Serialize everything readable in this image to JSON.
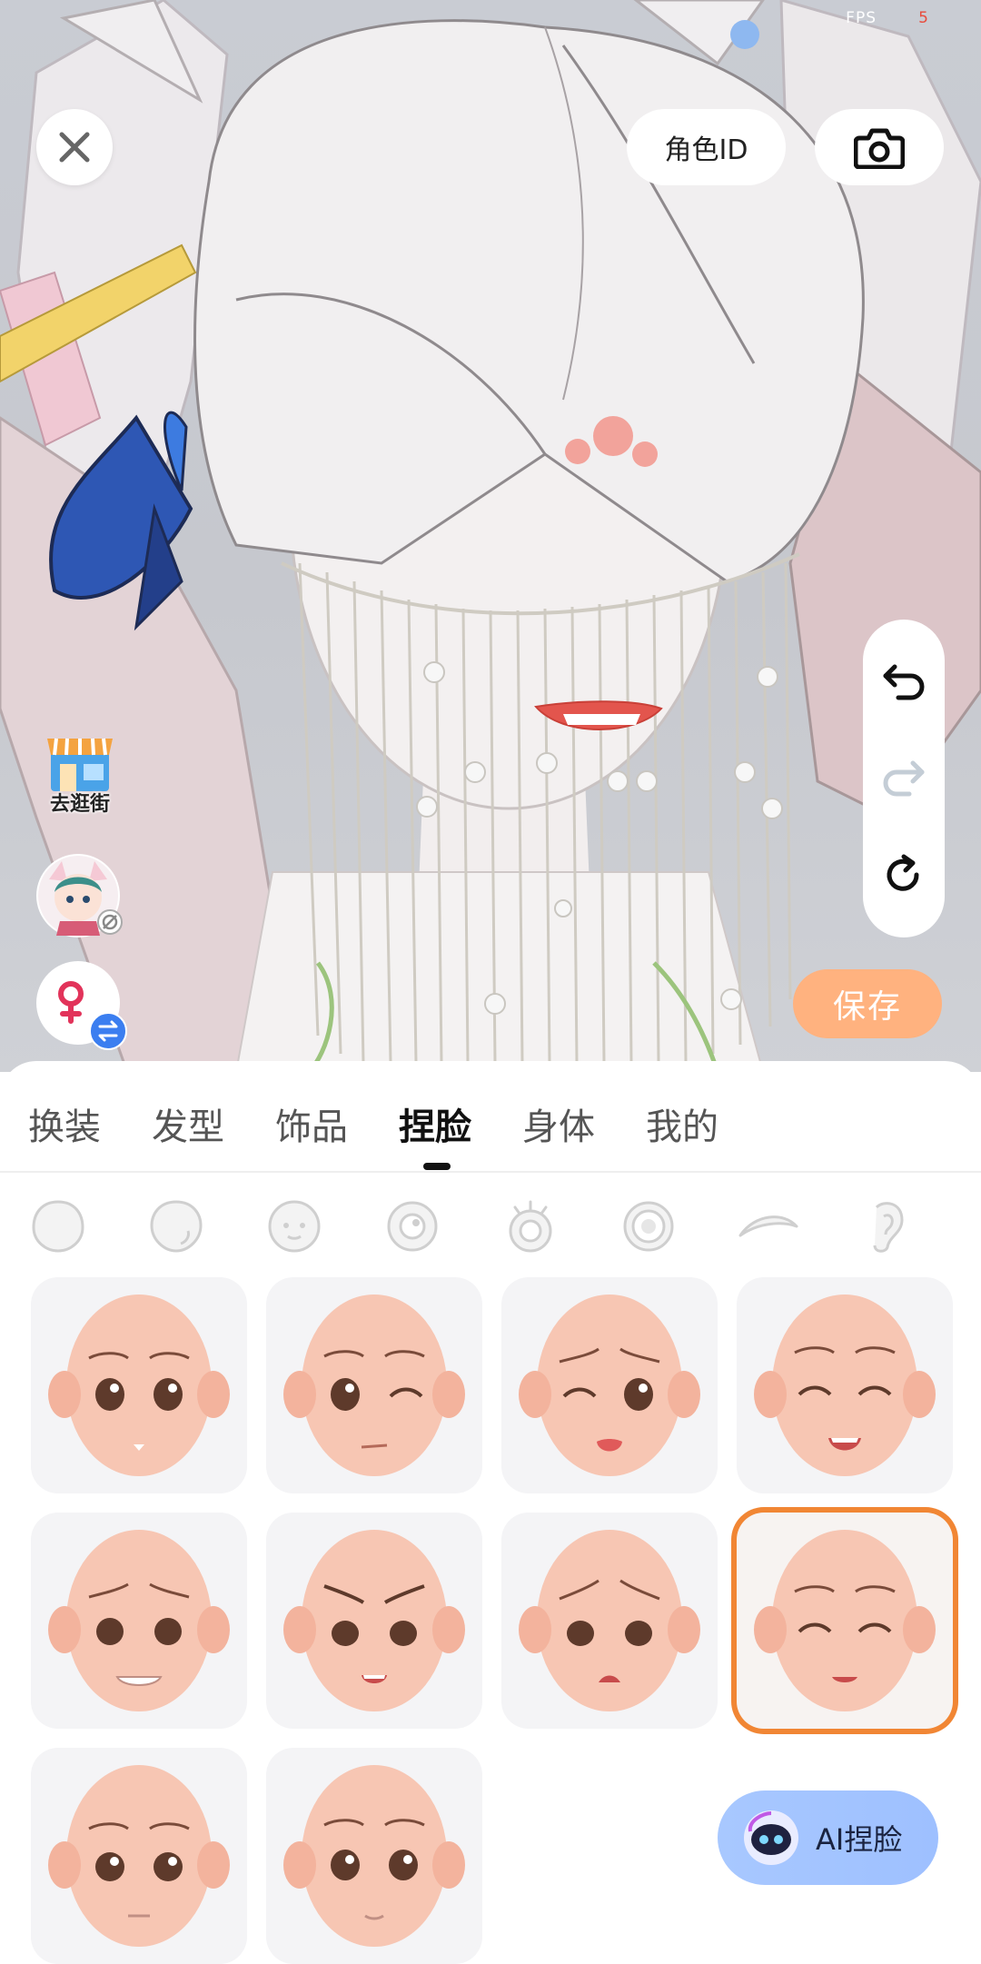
{
  "hud": {
    "fps_label": "FPS",
    "fps_value": "5"
  },
  "top": {
    "close_icon": "close-icon",
    "role_id_label": "角色ID",
    "camera_icon": "camera-icon"
  },
  "side": {
    "shop_label": "去逛街",
    "shop_icon": "storefront-icon",
    "gender_icon": "female-swap-icon"
  },
  "history": {
    "undo_icon": "undo-icon",
    "redo_icon": "redo-icon",
    "reset_icon": "reset-icon"
  },
  "save_label": "保存",
  "tabs": [
    {
      "label": "换装"
    },
    {
      "label": "发型"
    },
    {
      "label": "饰品"
    },
    {
      "label": "捏脸",
      "active": true
    },
    {
      "label": "身体"
    },
    {
      "label": "我的"
    }
  ],
  "subcategories": [
    "face-shape-icon",
    "face-contour-icon",
    "face-features-icon",
    "eye-icon",
    "eyelash-icon",
    "pupil-icon",
    "eyebrow-icon",
    "ear-icon"
  ],
  "face_presets": [
    {
      "name": "neutral-preset",
      "selected": false
    },
    {
      "name": "wink-preset",
      "selected": false
    },
    {
      "name": "tongue-out-preset",
      "selected": false
    },
    {
      "name": "happy-smile-preset",
      "selected": false
    },
    {
      "name": "worried-grin-preset",
      "selected": false
    },
    {
      "name": "angry-preset",
      "selected": false
    },
    {
      "name": "sad-preset",
      "selected": false
    },
    {
      "name": "closed-eye-smile-preset",
      "selected": true
    },
    {
      "name": "calm-preset",
      "selected": false
    },
    {
      "name": "gentle-preset",
      "selected": false
    }
  ],
  "ai_button_label": "AI捏脸",
  "colors": {
    "accent_orange": "#f18634",
    "save_bg": "#ffb27f",
    "ai_bg": "#a8c8ff",
    "fps_red": "#e84b3c"
  }
}
